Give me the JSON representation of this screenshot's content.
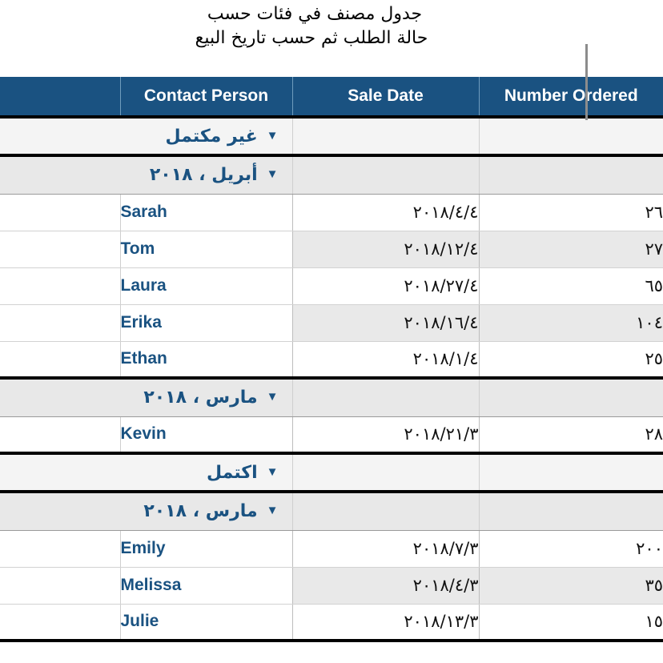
{
  "caption": {
    "line1": "جدول مصنف في فئات حسب",
    "line2": "حالة الطلب ثم حسب تاريخ البيع"
  },
  "colors": {
    "header_background": "#1a5281",
    "accent_text": "#1a5281",
    "stripe": "#e9e9e9",
    "group_level1": "#f4f4f4",
    "group_level2": "#e8e8e8",
    "leader_line": "#8c8c8c"
  },
  "icons": {
    "disclosure": "▼"
  },
  "table": {
    "columns": [
      {
        "key": "number_ordered",
        "label": "Number Ordered"
      },
      {
        "key": "sale_date",
        "label": "Sale Date"
      },
      {
        "key": "contact_person",
        "label": "Contact Person"
      },
      {
        "key": "spacer",
        "label": ""
      }
    ],
    "rows": [
      {
        "type": "group",
        "level": 1,
        "label": "غير مكتمل"
      },
      {
        "type": "group",
        "level": 2,
        "label": "أبريل ، ٢٠١٨"
      },
      {
        "type": "data",
        "number_ordered": "٢٦",
        "sale_date": "٢٠١٨/٤/٤",
        "contact_person": "Sarah",
        "stripe": false
      },
      {
        "type": "data",
        "number_ordered": "٢٧",
        "sale_date": "٢٠١٨/١٢/٤",
        "contact_person": "Tom",
        "stripe": true
      },
      {
        "type": "data",
        "number_ordered": "٦٥",
        "sale_date": "٢٠١٨/٢٧/٤",
        "contact_person": "Laura",
        "stripe": false
      },
      {
        "type": "data",
        "number_ordered": "١٠٤",
        "sale_date": "٢٠١٨/١٦/٤",
        "contact_person": "Erika",
        "stripe": true
      },
      {
        "type": "data",
        "number_ordered": "٢٥",
        "sale_date": "٢٠١٨/١/٤",
        "contact_person": "Ethan",
        "stripe": false,
        "last_in_group": true
      },
      {
        "type": "group",
        "level": 2,
        "label": "مارس ، ٢٠١٨"
      },
      {
        "type": "data",
        "number_ordered": "٢٨",
        "sale_date": "٢٠١٨/٢١/٣",
        "contact_person": "Kevin",
        "stripe": false,
        "last_in_group": true
      },
      {
        "type": "group",
        "level": 1,
        "label": "اكتمل"
      },
      {
        "type": "group",
        "level": 2,
        "label": "مارس ، ٢٠١٨"
      },
      {
        "type": "data",
        "number_ordered": "٢٠٠",
        "sale_date": "٢٠١٨/٧/٣",
        "contact_person": "Emily",
        "stripe": false
      },
      {
        "type": "data",
        "number_ordered": "٣٥",
        "sale_date": "٢٠١٨/٤/٣",
        "contact_person": "Melissa",
        "stripe": true
      },
      {
        "type": "data",
        "number_ordered": "١٥",
        "sale_date": "٢٠١٨/١٣/٣",
        "contact_person": "Julie",
        "stripe": false,
        "table_end": true
      }
    ]
  }
}
